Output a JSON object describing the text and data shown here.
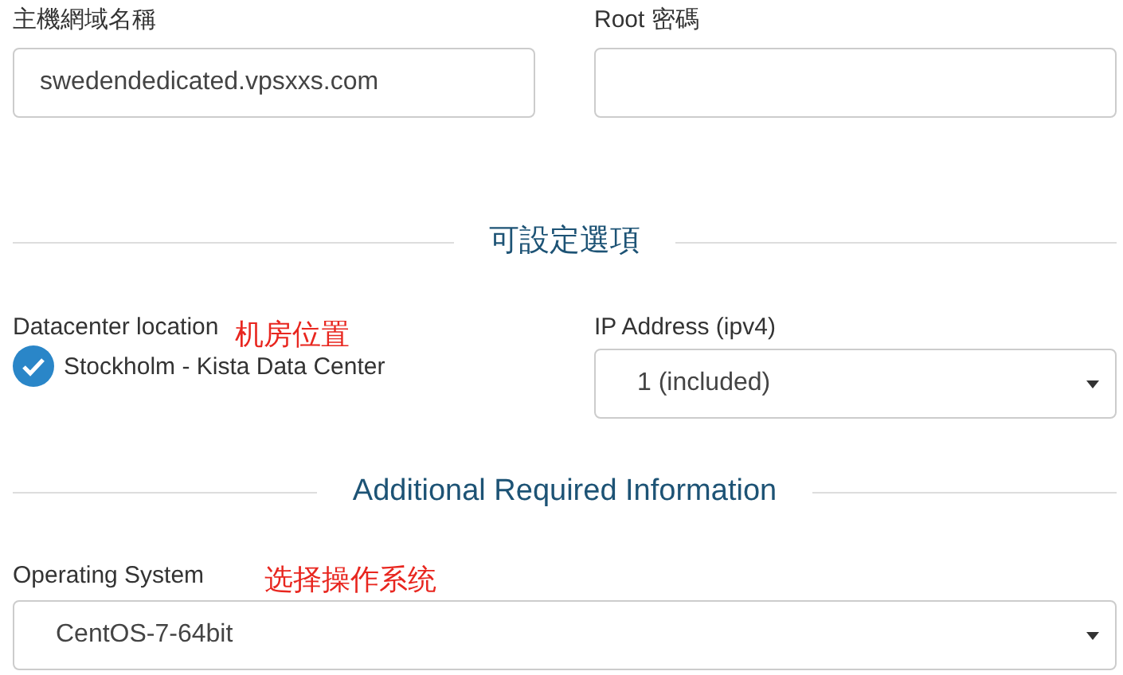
{
  "fields": [
    {
      "label": "主機網域名稱",
      "value": "swedendedicated.vpsxxs.com"
    },
    {
      "label": "Root 密碼"
    }
  ],
  "section_1": {
    "title": "可設定選項"
  },
  "datacenter": {
    "label": "Datacenter location",
    "note": "机房位置",
    "option": {
      "label": "Stockholm - Kista Data Center",
      "checked": true
    }
  },
  "ip_address": {
    "label": "IP Address (ipv4)",
    "value": "1 (included)"
  },
  "section_2": {
    "title": "Additional Required Information"
  },
  "operating_system": {
    "label": "Operating System",
    "note": "选择操作系统",
    "value": "CentOS-7-64bit"
  }
}
